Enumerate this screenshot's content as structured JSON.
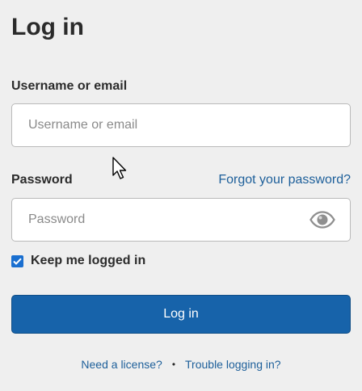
{
  "title": "Log in",
  "username": {
    "label": "Username or email",
    "placeholder": "Username or email",
    "value": ""
  },
  "password": {
    "label": "Password",
    "placeholder": "Password",
    "value": "",
    "forgot_link": "Forgot your password?",
    "toggle_icon": "eye-icon"
  },
  "remember": {
    "label": "Keep me logged in",
    "checked": true
  },
  "login_button": "Log in",
  "footer": {
    "license_link": "Need a license?",
    "separator": "•",
    "trouble_link": "Trouble logging in?"
  },
  "colors": {
    "background": "#efefef",
    "primary_button": "#1763aa",
    "link": "#1d5f9a",
    "checkbox": "#1a6fd0"
  }
}
